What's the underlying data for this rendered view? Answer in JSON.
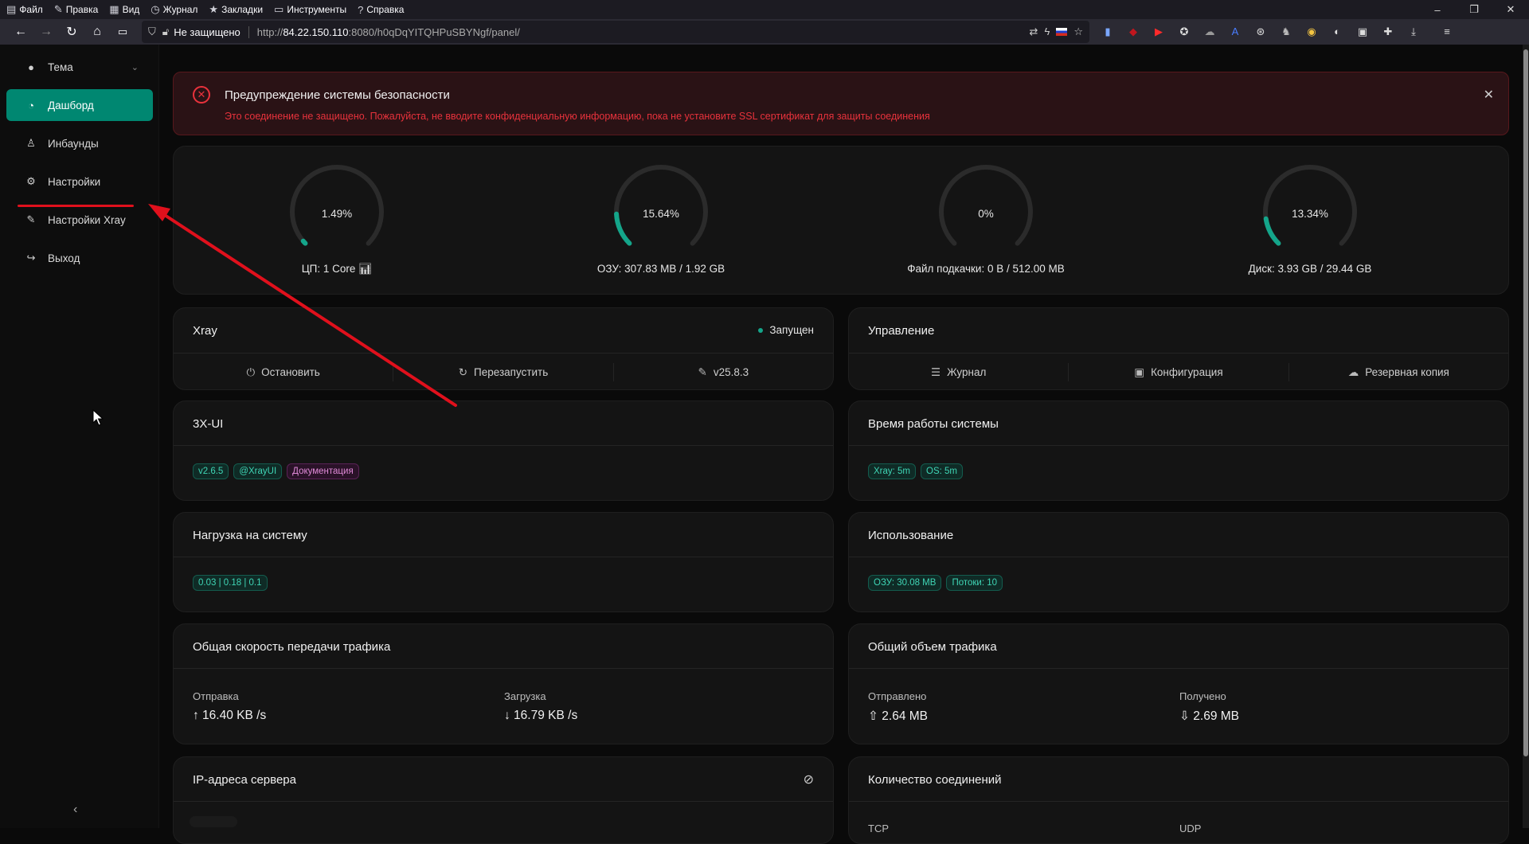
{
  "menubar": {
    "items": [
      {
        "icon": "file-icon",
        "glyph": "▤",
        "label": "Файл"
      },
      {
        "icon": "edit-icon",
        "glyph": "✎",
        "label": "Правка"
      },
      {
        "icon": "view-icon",
        "glyph": "▦",
        "label": "Вид"
      },
      {
        "icon": "history-icon",
        "glyph": "◷",
        "label": "Журнал"
      },
      {
        "icon": "bookmark-star-icon",
        "glyph": "★",
        "label": "Закладки"
      },
      {
        "icon": "tools-icon",
        "glyph": "▭",
        "label": "Инструменты"
      },
      {
        "icon": "help-icon",
        "glyph": "?",
        "label": "Справка"
      }
    ]
  },
  "window": {
    "minimize": "–",
    "restore": "❐",
    "close": "✕"
  },
  "navbar": {
    "back": "←",
    "forward": "→",
    "reload": "↻",
    "home": "⌂",
    "tabs": "▭",
    "shield": "⛉",
    "lock": "🔓︎",
    "security_text": "Не защищено",
    "url_scheme": "http://",
    "url_host": "84.22.150.110",
    "url_rest": ":8080/h0qDqYITQHPuSBYNgf/panel/"
  },
  "sidebar": {
    "theme": {
      "label": "Тема",
      "glyph": "●"
    },
    "items": [
      {
        "label": "Дашборд",
        "glyph": "◔"
      },
      {
        "label": "Инбаунды",
        "glyph": "♙"
      },
      {
        "label": "Настройки",
        "glyph": "⚙"
      },
      {
        "label": "Настройки Xray",
        "glyph": "✎"
      },
      {
        "label": "Выход",
        "glyph": "↪"
      }
    ],
    "collapse": "‹"
  },
  "alert": {
    "title": "Предупреждение системы безопасности",
    "description": "Это соединение не защищено. Пожалуйста, не вводите конфиденциальную информацию, пока не установите SSL сертификат для защиты соединения"
  },
  "gauges": [
    {
      "percent": 1.49,
      "value": "1.49%",
      "label": "ЦП: 1 Core 📊︎"
    },
    {
      "percent": 15.64,
      "value": "15.64%",
      "label": "ОЗУ: 307.83 MB / 1.92 GB"
    },
    {
      "percent": 0,
      "value": "0%",
      "label": "Файл подкачки: 0 B / 512.00 MB"
    },
    {
      "percent": 13.34,
      "value": "13.34%",
      "label": "Диск: 3.93 GB / 29.44 GB"
    }
  ],
  "xray": {
    "title": "Xray",
    "status": "Запущен",
    "actions": [
      {
        "glyph": "⏻",
        "label": "Остановить"
      },
      {
        "glyph": "↻",
        "label": "Перезапустить"
      },
      {
        "glyph": "✎",
        "label": "v25.8.3"
      }
    ]
  },
  "management": {
    "title": "Управление",
    "actions": [
      {
        "glyph": "☰",
        "label": "Журнал"
      },
      {
        "glyph": "▣",
        "label": "Конфигурация"
      },
      {
        "glyph": "☁",
        "label": "Резервная копия"
      }
    ]
  },
  "panel3xui": {
    "title": "3X-UI",
    "tags": [
      "v2.6.5",
      "@XrayUI",
      "Документация"
    ]
  },
  "uptime": {
    "title": "Время работы системы",
    "tags": [
      "Xray: 5m",
      "OS: 5m"
    ]
  },
  "load": {
    "title": "Нагрузка на систему",
    "tags": [
      "0.03 | 0.18 | 0.1"
    ]
  },
  "usage": {
    "title": "Использование",
    "tags": [
      "ОЗУ: 30.08 MB",
      "Потоки: 10"
    ]
  },
  "speed": {
    "title": "Общая скорость передачи трафика",
    "up_label": "Отправка",
    "up_value": "↑ 16.40 KB /s",
    "down_label": "Загрузка",
    "down_value": "↓ 16.79 KB /s"
  },
  "traffic": {
    "title": "Общий объем трафика",
    "sent_label": "Отправлено",
    "sent_value": "⇧ 2.64 MB",
    "recv_label": "Получено",
    "recv_value": "⇩ 2.69 MB"
  },
  "ip": {
    "title": "IP-адреса сервера",
    "toggle_glyph": "⊘"
  },
  "connections": {
    "title": "Количество соединений",
    "tcp": "TCP",
    "udp": "UDP"
  },
  "colors": {
    "accent": "#008771",
    "gauge": "#14a58a",
    "alert": "#e8323c",
    "annotation": "#e0101c"
  }
}
